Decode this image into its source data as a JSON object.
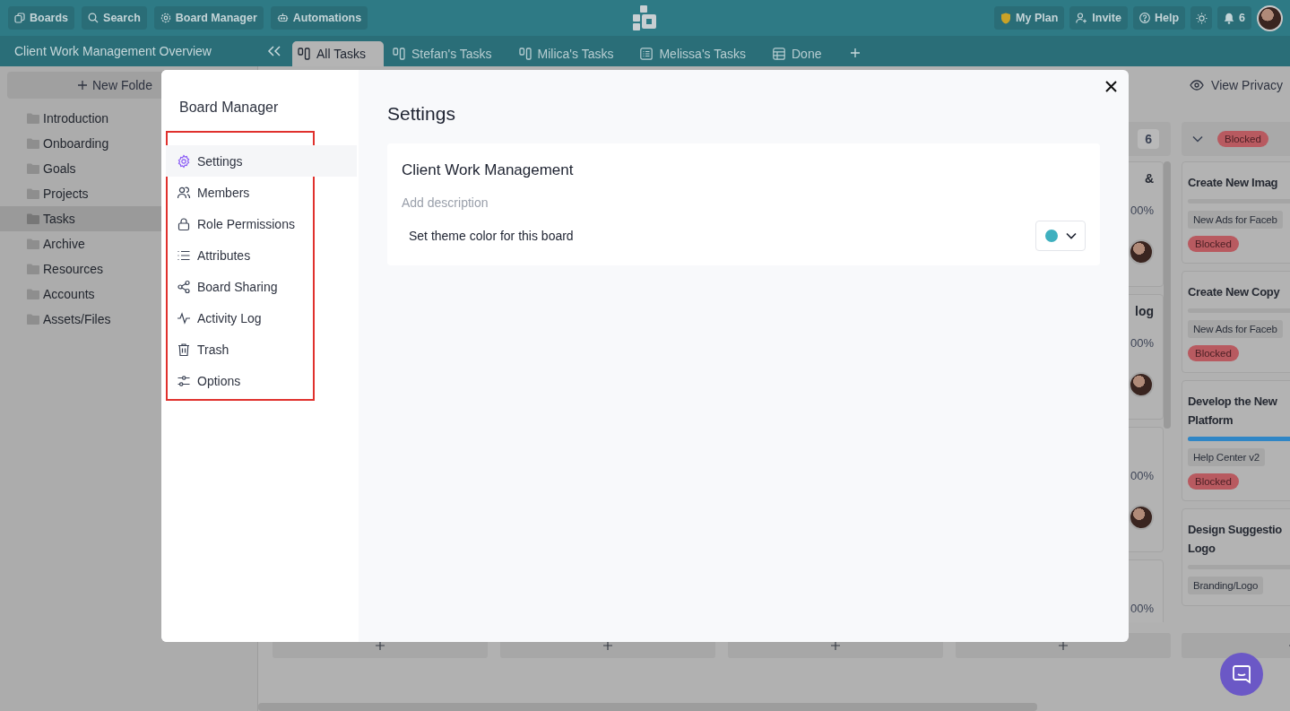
{
  "top_bar": {
    "left_buttons": [
      {
        "label": "Boards"
      },
      {
        "label": "Search"
      },
      {
        "label": "Board Manager"
      },
      {
        "label": "Automations"
      }
    ],
    "right_buttons": [
      {
        "label": "My Plan"
      },
      {
        "label": "Invite"
      },
      {
        "label": "Help"
      }
    ],
    "notifications": "6"
  },
  "board_title": "Client Work Management Overview",
  "tabs": [
    {
      "label": "All Tasks",
      "selected": true,
      "kind": "board"
    },
    {
      "label": "Stefan's Tasks",
      "selected": false,
      "kind": "board"
    },
    {
      "label": "Milica's Tasks",
      "selected": false,
      "kind": "board"
    },
    {
      "label": "Melissa's Tasks",
      "selected": false,
      "kind": "list"
    },
    {
      "label": "Done",
      "selected": false,
      "kind": "table"
    }
  ],
  "sidebar": {
    "new_folder": "New Folde",
    "folders": [
      {
        "label": "Introduction",
        "selected": false
      },
      {
        "label": "Onboarding",
        "selected": false
      },
      {
        "label": "Goals",
        "selected": false
      },
      {
        "label": "Projects",
        "selected": false
      },
      {
        "label": "Tasks",
        "selected": true
      },
      {
        "label": "Archive",
        "selected": false
      },
      {
        "label": "Resources",
        "selected": false
      },
      {
        "label": "Accounts",
        "selected": false
      },
      {
        "label": "Assets/Files",
        "selected": false
      }
    ]
  },
  "board": {
    "view_privacy": "View Privacy",
    "columns": [
      {
        "kind": "hidden"
      },
      {
        "kind": "hidden"
      },
      {
        "kind": "hidden"
      },
      {
        "kind": "partial",
        "count": "6",
        "cards": [
          {
            "title": "&",
            "progress": "00%",
            "avatar": true
          },
          {
            "title": "log",
            "progress": "00%",
            "avatar": true
          },
          {
            "progress": "00%",
            "avatar": true
          },
          {
            "progress": "00%"
          }
        ]
      },
      {
        "kind": "full",
        "status": {
          "label": "Blocked",
          "color": "#b85a60"
        },
        "cards": [
          {
            "title": [
              "Create New Imag"
            ],
            "tag": "New Ads for Faceb",
            "status": {
              "label": "Blocked",
              "color": "#b85a60"
            }
          },
          {
            "title": [
              "Create New Copy"
            ],
            "tag": "New Ads for Faceb",
            "status": {
              "label": "Blocked",
              "color": "#b85a60"
            }
          },
          {
            "title": [
              "Develop the New",
              "Platform"
            ],
            "level": 0.5,
            "tag": "Help Center v2",
            "status": {
              "label": "Blocked",
              "color": "#b85a60"
            }
          },
          {
            "title": [
              "Design Suggestio",
              "Logo"
            ],
            "tag": "Branding/Logo"
          }
        ]
      }
    ]
  },
  "modal": {
    "title": "Board Manager",
    "nav": [
      {
        "label": "Settings",
        "selected": true
      },
      {
        "label": "Members",
        "selected": false
      },
      {
        "label": "Role Permissions",
        "selected": false
      },
      {
        "label": "Attributes",
        "selected": false
      },
      {
        "label": "Board Sharing",
        "selected": false
      },
      {
        "label": "Activity Log",
        "selected": false
      },
      {
        "label": "Trash",
        "selected": false
      },
      {
        "label": "Options",
        "selected": false
      }
    ],
    "heading": "Settings",
    "board_name": "Client Work Management",
    "description_placeholder": "Add description",
    "theme": {
      "label": "Set theme color for this board",
      "color": "#3fb0bf"
    }
  }
}
